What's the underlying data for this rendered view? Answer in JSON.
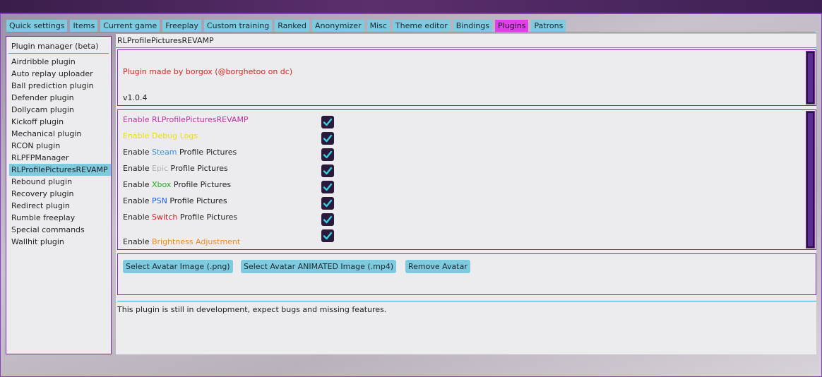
{
  "tabs": [
    {
      "label": "Quick settings",
      "active": false
    },
    {
      "label": "Items",
      "active": false
    },
    {
      "label": "Current game",
      "active": false
    },
    {
      "label": "Freeplay",
      "active": false
    },
    {
      "label": "Custom training",
      "active": false
    },
    {
      "label": "Ranked",
      "active": false
    },
    {
      "label": "Anonymizer",
      "active": false
    },
    {
      "label": "Misc",
      "active": false
    },
    {
      "label": "Theme editor",
      "active": false
    },
    {
      "label": "Bindings",
      "active": false
    },
    {
      "label": "Plugins",
      "active": true
    },
    {
      "label": "Patrons",
      "active": false
    }
  ],
  "sidebar": {
    "title": "Plugin manager (beta)",
    "items": [
      {
        "label": "Airdribble plugin",
        "selected": false
      },
      {
        "label": "Auto replay uploader",
        "selected": false
      },
      {
        "label": "Ball prediction plugin",
        "selected": false
      },
      {
        "label": "Defender plugin",
        "selected": false
      },
      {
        "label": "Dollycam plugin",
        "selected": false
      },
      {
        "label": "Kickoff plugin",
        "selected": false
      },
      {
        "label": "Mechanical plugin",
        "selected": false
      },
      {
        "label": "RCON plugin",
        "selected": false
      },
      {
        "label": "RLPFPManager",
        "selected": false
      },
      {
        "label": "RLProfilePicturesREVAMP",
        "selected": true
      },
      {
        "label": "Rebound plugin",
        "selected": false
      },
      {
        "label": "Recovery plugin",
        "selected": false
      },
      {
        "label": "Redirect plugin",
        "selected": false
      },
      {
        "label": "Rumble freeplay",
        "selected": false
      },
      {
        "label": "Special commands",
        "selected": false
      },
      {
        "label": "Wallhit plugin",
        "selected": false
      }
    ]
  },
  "main": {
    "title": "RLProfilePicturesREVAMP",
    "info": {
      "made_by": "Plugin made by borgox (@borghetoo on dc)",
      "version": "v1.0.4"
    },
    "settings": [
      {
        "prefix": "Enable ",
        "highlight": "RLProfilePicturesREVAMP",
        "suffix": "",
        "prefix_color": "#c030a0",
        "highlight_color": "#c030a0",
        "checked": true
      },
      {
        "prefix": "Enable ",
        "highlight": "Debug Logs",
        "suffix": "",
        "prefix_color": "#e8e000",
        "highlight_color": "#e8e000",
        "checked": true
      },
      {
        "prefix": "Enable ",
        "highlight": "Steam",
        "suffix": " Profile Pictures",
        "prefix_color": "#222222",
        "highlight_color": "#3a90e0",
        "checked": true
      },
      {
        "prefix": "Enable ",
        "highlight": "Epic",
        "suffix": " Profile Pictures",
        "prefix_color": "#222222",
        "highlight_color": "#b0b0b0",
        "checked": true
      },
      {
        "prefix": "Enable ",
        "highlight": "Xbox",
        "suffix": " Profile Pictures",
        "prefix_color": "#222222",
        "highlight_color": "#20b020",
        "checked": true
      },
      {
        "prefix": "Enable ",
        "highlight": "PSN",
        "suffix": " Profile Pictures",
        "prefix_color": "#222222",
        "highlight_color": "#2060e0",
        "checked": true
      },
      {
        "prefix": "Enable ",
        "highlight": "Switch",
        "suffix": " Profile Pictures",
        "prefix_color": "#222222",
        "highlight_color": "#e02020",
        "checked": true
      },
      {
        "prefix": "Enable ",
        "highlight": "Brightness Adjustment",
        "suffix": "",
        "prefix_color": "#222222",
        "highlight_color": "#f08a20",
        "checked": true
      }
    ],
    "buttons": [
      {
        "label": "Select Avatar Image (.png)"
      },
      {
        "label": "Select Avatar ANIMATED Image (.mp4)"
      },
      {
        "label": "Remove Avatar"
      }
    ],
    "footer": "This plugin is still in development, expect bugs and missing features."
  },
  "colors": {
    "tab": "#7ecbe0",
    "tab_active": "#e040e8",
    "accent_border": "#7a2fb0",
    "checkmark": "#3ad0e0",
    "made_by": "#e02020"
  },
  "icons": {
    "checkbox": "checkmark-icon",
    "scroll_thumb": "scrollbar-thumb"
  }
}
